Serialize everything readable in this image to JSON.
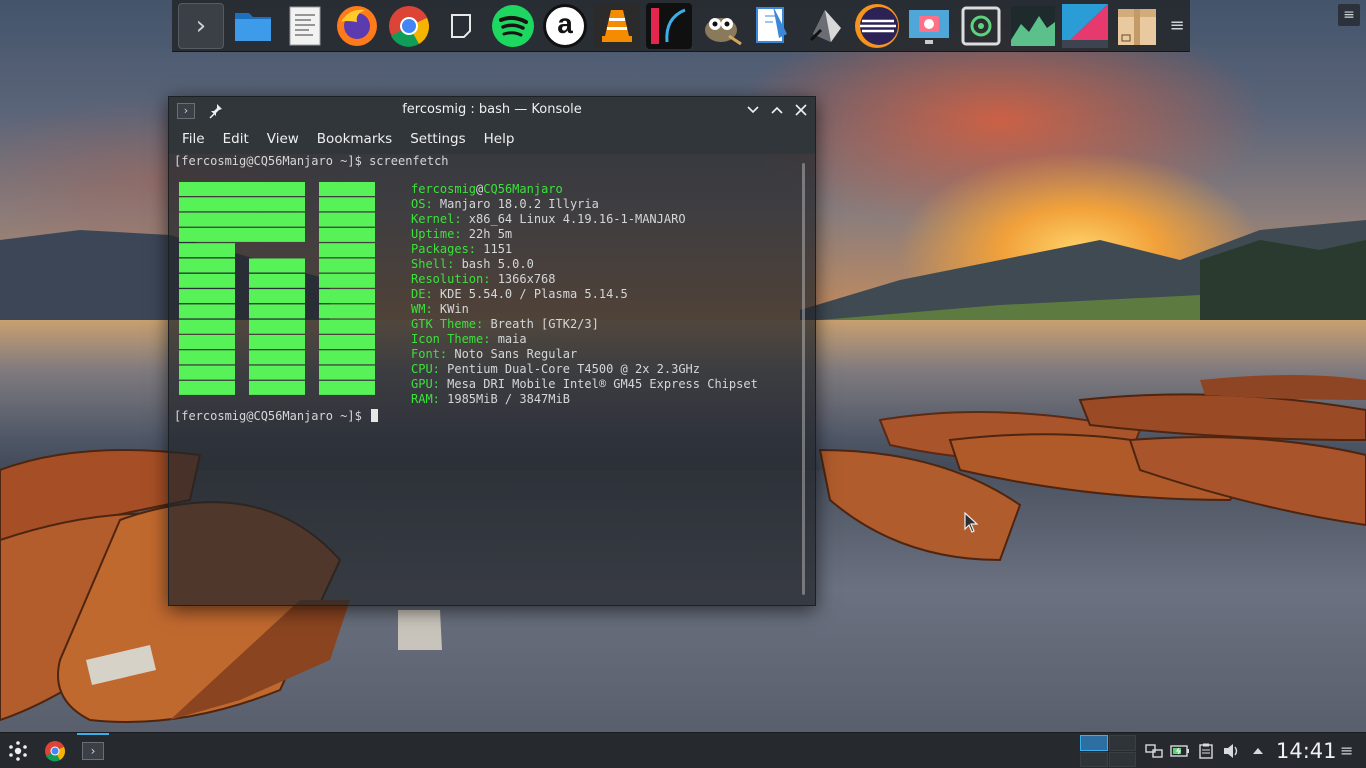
{
  "dock": {
    "items": [
      {
        "name": "konsole-icon",
        "glyph": "›"
      },
      {
        "name": "file-manager-icon"
      },
      {
        "name": "text-editor-icon"
      },
      {
        "name": "firefox-icon"
      },
      {
        "name": "chrome-icon"
      },
      {
        "name": "notes-icon"
      },
      {
        "name": "spotify-icon"
      },
      {
        "name": "amarok-icon",
        "glyph": "a"
      },
      {
        "name": "vlc-icon"
      },
      {
        "name": "krita-icon"
      },
      {
        "name": "gimp-icon"
      },
      {
        "name": "inkscape-icon"
      },
      {
        "name": "pen-tool-icon"
      },
      {
        "name": "eclipse-icon"
      },
      {
        "name": "screenshot-icon"
      },
      {
        "name": "screen-recorder-icon"
      },
      {
        "name": "system-monitor-icon"
      },
      {
        "name": "kde-app-icon"
      },
      {
        "name": "archive-manager-icon"
      }
    ]
  },
  "konsole": {
    "title": "fercosmig : bash — Konsole",
    "menu": [
      "File",
      "Edit",
      "View",
      "Bookmarks",
      "Settings",
      "Help"
    ],
    "prompt1": "[fercosmig@CQ56Manjaro ~]$ screenfetch",
    "prompt2": "[fercosmig@CQ56Manjaro ~]$ ",
    "user": "fercosmig",
    "at": "@",
    "host": "CQ56Manjaro",
    "info": [
      {
        "key": "OS:",
        "value": " Manjaro 18.0.2 Illyria"
      },
      {
        "key": "Kernel:",
        "value": " x86_64 Linux 4.19.16-1-MANJARO"
      },
      {
        "key": "Uptime:",
        "value": " 22h 5m"
      },
      {
        "key": "Packages:",
        "value": " 1151"
      },
      {
        "key": "Shell:",
        "value": " bash 5.0.0"
      },
      {
        "key": "Resolution:",
        "value": " 1366x768"
      },
      {
        "key": "DE:",
        "value": " KDE 5.54.0 / Plasma 5.14.5"
      },
      {
        "key": "WM:",
        "value": " KWin"
      },
      {
        "key": "GTK Theme:",
        "value": " Breath [GTK2/3]"
      },
      {
        "key": "Icon Theme:",
        "value": " maia"
      },
      {
        "key": "Font:",
        "value": " Noto Sans Regular"
      },
      {
        "key": "CPU:",
        "value": " Pentium Dual-Core T4500 @ 2x 2.3GHz"
      },
      {
        "key": "GPU:",
        "value": " Mesa DRI Mobile Intel® GM45 Express Chipset"
      },
      {
        "key": "RAM:",
        "value": " 1985MiB / 3847MiB"
      }
    ],
    "logo_color": "#57f257"
  },
  "panel": {
    "clock": "14:41",
    "accent": "#3daee9"
  }
}
